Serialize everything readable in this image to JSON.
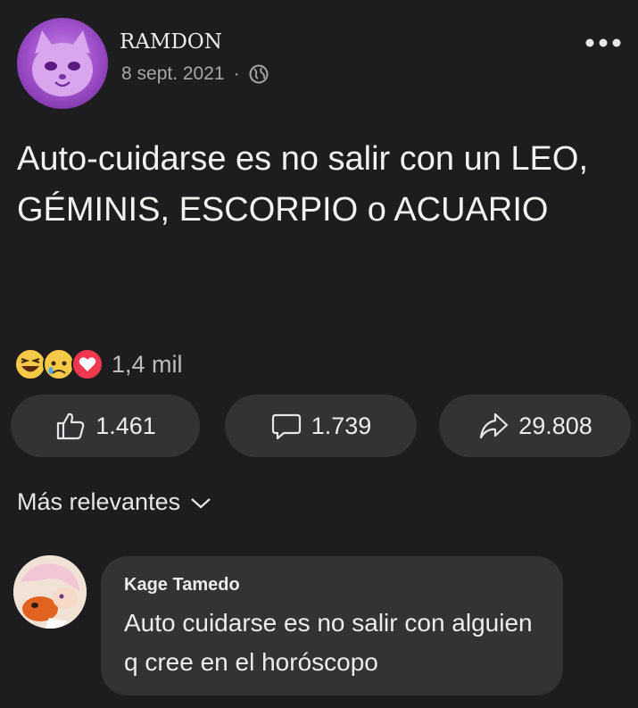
{
  "post": {
    "author": "RAMDON",
    "date": "8 sept. 2021",
    "separator": "·",
    "privacy_icon": "globe-icon",
    "text": "Auto-cuidarse es no salir con un LEO, GÉMINIS, ESCORPIO o ACUARIO"
  },
  "reactions": {
    "icons": [
      "haha-icon",
      "sad-icon",
      "love-icon"
    ],
    "count": "1,4 mil"
  },
  "actions": {
    "like_count": "1.461",
    "comment_count": "1.739",
    "share_count": "29.808"
  },
  "comments_section": {
    "sort_label": "Más relevantes"
  },
  "comment": {
    "author": "Kage Tamedo",
    "text": "Auto cuidarse es no salir con alguien q cree en el horóscopo"
  },
  "colors": {
    "background": "#1d1d1f",
    "pill": "#333336",
    "love_red": "#f0384f",
    "emoji_yellow": "#f7c948",
    "avatar_purple": "#a555d0"
  }
}
